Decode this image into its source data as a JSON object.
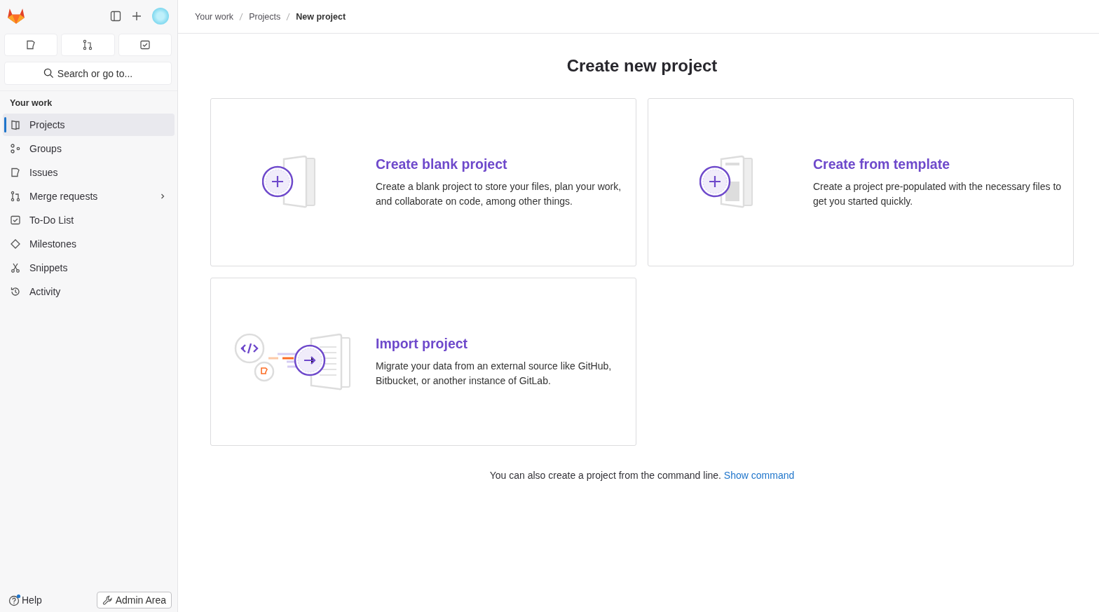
{
  "sidebar": {
    "search": {
      "placeholder": "Search or go to..."
    },
    "section_title": "Your work",
    "items": [
      {
        "label": "Projects",
        "kind": "projects",
        "selected": true
      },
      {
        "label": "Groups",
        "kind": "groups",
        "selected": false
      },
      {
        "label": "Issues",
        "kind": "issues",
        "selected": false
      },
      {
        "label": "Merge requests",
        "kind": "merge",
        "selected": false,
        "submenu": true
      },
      {
        "label": "To-Do List",
        "kind": "todo",
        "selected": false
      },
      {
        "label": "Milestones",
        "kind": "milestones",
        "selected": false
      },
      {
        "label": "Snippets",
        "kind": "snippets",
        "selected": false
      },
      {
        "label": "Activity",
        "kind": "activity",
        "selected": false
      }
    ],
    "help": {
      "label": "Help",
      "unread": true
    },
    "admin_button": "Admin Area"
  },
  "breadcrumbs": [
    {
      "label": "Your work",
      "current": false
    },
    {
      "label": "Projects",
      "current": false
    },
    {
      "label": "New project",
      "current": true
    }
  ],
  "page_title": "Create new project",
  "cards": [
    {
      "kind": "blank",
      "title": "Create blank project",
      "description": "Create a blank project to store your files, plan your work, and collaborate on code, among other things."
    },
    {
      "kind": "template",
      "title": "Create from template",
      "description": "Create a project pre-populated with the necessary files to get you started quickly."
    },
    {
      "kind": "import",
      "title": "Import project",
      "description": "Migrate your data from an external source like GitHub, Bitbucket, or another instance of GitLab."
    }
  ],
  "footer": {
    "text": "You can also create a project from the command line.",
    "link": "Show command"
  }
}
